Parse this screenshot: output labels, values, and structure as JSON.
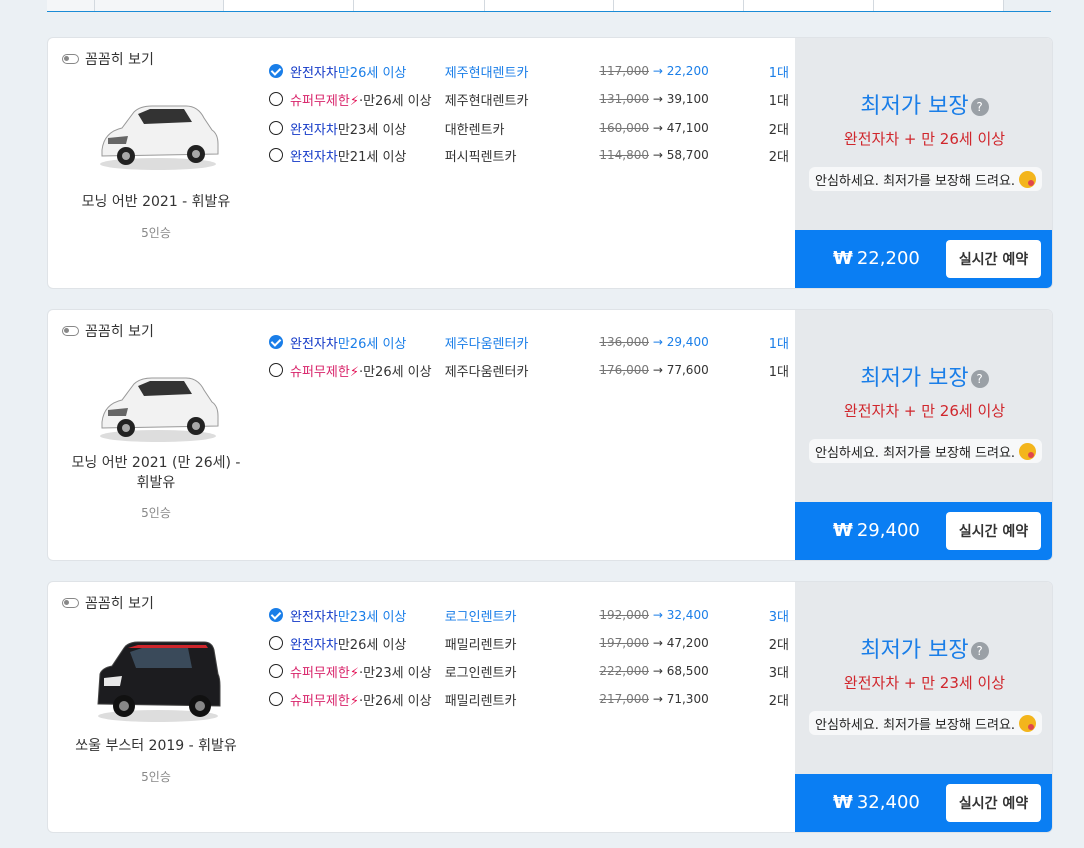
{
  "common": {
    "toggle_label": "꼼꼼히 보기",
    "best_price": "최저가 보장",
    "help_mark": "?",
    "reassure": "안심하세요. 최저가를 보장해 드려요.",
    "reserve": "실시간 예약",
    "won": "₩",
    "arrow": "→"
  },
  "cards": [
    {
      "car_name": "모닝 어반 2021 - 휘발유",
      "seats": "5인승",
      "car_color": "#f2f2f2",
      "guarantee_condition": "완전자차 + 만 26세 이상",
      "total": "22,200",
      "options": [
        {
          "kind": "완전자차",
          "kind_type": "full",
          "age": "만26세 이상",
          "company": "제주현대렌트카",
          "orig": "117,000",
          "now": "22,200",
          "count": "1대",
          "selected": true
        },
        {
          "kind": "슈퍼무제한",
          "kind_type": "super",
          "age": "·만26세 이상",
          "company": "제주현대렌트카",
          "orig": "131,000",
          "now": "39,100",
          "count": "1대",
          "selected": false
        },
        {
          "kind": "완전자차",
          "kind_type": "full",
          "age": "만23세 이상",
          "company": "대한렌트카",
          "orig": "160,000",
          "now": "47,100",
          "count": "2대",
          "selected": false
        },
        {
          "kind": "완전자차",
          "kind_type": "full",
          "age": "만21세 이상",
          "company": "퍼시픽렌트카",
          "orig": "114,800",
          "now": "58,700",
          "count": "2대",
          "selected": false
        }
      ]
    },
    {
      "car_name": "모닝 어반 2021 (만 26세) - 휘발유",
      "seats": "5인승",
      "car_color": "#f2f2f2",
      "guarantee_condition": "완전자차 + 만 26세 이상",
      "total": "29,400",
      "options": [
        {
          "kind": "완전자차",
          "kind_type": "full",
          "age": "만26세 이상",
          "company": "제주다움렌터카",
          "orig": "136,000",
          "now": "29,400",
          "count": "1대",
          "selected": true
        },
        {
          "kind": "슈퍼무제한",
          "kind_type": "super",
          "age": "·만26세 이상",
          "company": "제주다움렌터카",
          "orig": "176,000",
          "now": "77,600",
          "count": "1대",
          "selected": false
        }
      ]
    },
    {
      "car_name": "쏘울 부스터 2019 - 휘발유",
      "seats": "5인승",
      "car_color": "#1c1c1f",
      "guarantee_condition": "완전자차 + 만 23세 이상",
      "total": "32,400",
      "options": [
        {
          "kind": "완전자차",
          "kind_type": "full",
          "age": "만23세 이상",
          "company": "로그인렌트카",
          "orig": "192,000",
          "now": "32,400",
          "count": "3대",
          "selected": true
        },
        {
          "kind": "완전자차",
          "kind_type": "full",
          "age": "만26세 이상",
          "company": "패밀리렌트카",
          "orig": "197,000",
          "now": "47,200",
          "count": "2대",
          "selected": false
        },
        {
          "kind": "슈퍼무제한",
          "kind_type": "super",
          "age": "·만23세 이상",
          "company": "로그인렌트카",
          "orig": "222,000",
          "now": "68,500",
          "count": "3대",
          "selected": false
        },
        {
          "kind": "슈퍼무제한",
          "kind_type": "super",
          "age": "·만26세 이상",
          "company": "패밀리렌트카",
          "orig": "217,000",
          "now": "71,300",
          "count": "2대",
          "selected": false
        }
      ]
    }
  ]
}
